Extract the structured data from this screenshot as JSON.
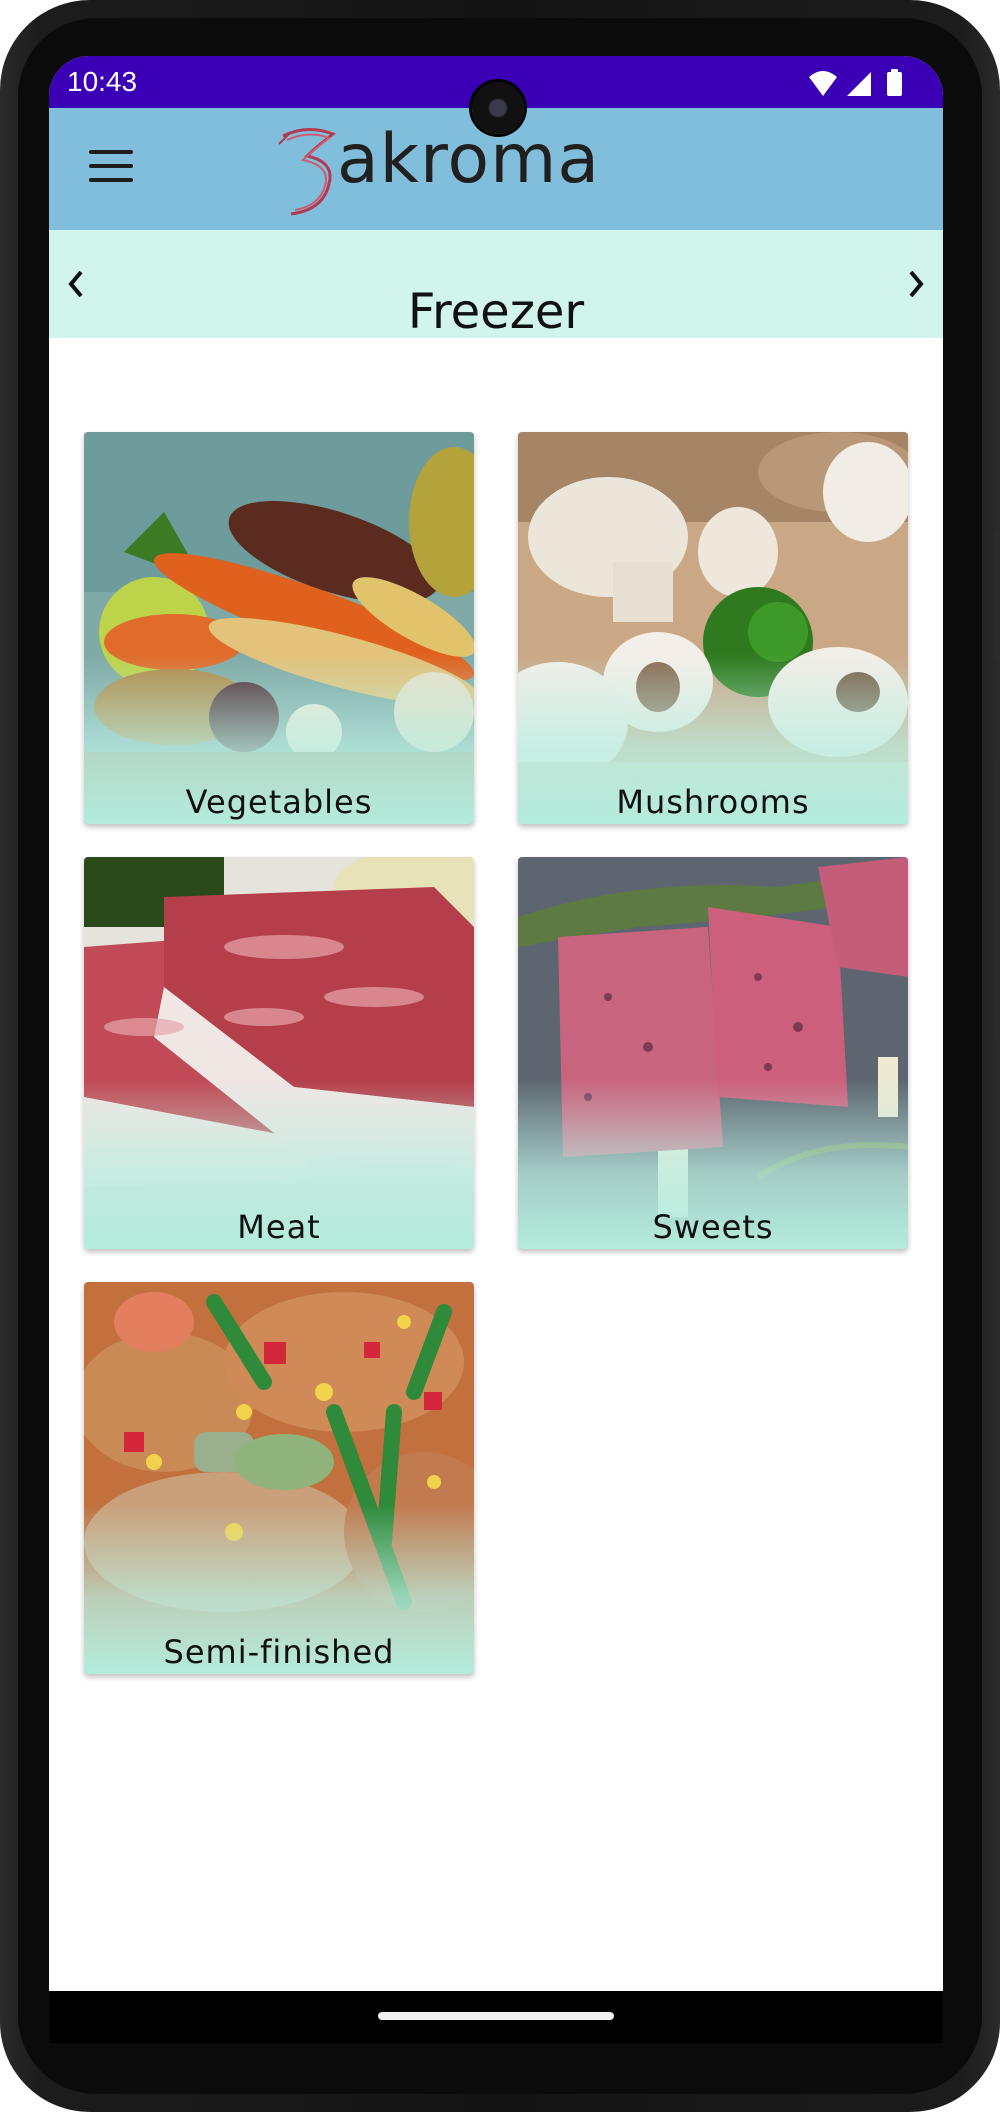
{
  "status_bar": {
    "time": "10:43",
    "icons": [
      "wifi-icon",
      "signal-icon",
      "battery-icon"
    ],
    "background": "#3b00b6"
  },
  "app_bar": {
    "brand_initial": "3",
    "brand_name": "akroma",
    "background": "#80bedc",
    "menu_icon": "hamburger-menu-icon"
  },
  "category_header": {
    "title": "Freezer",
    "prev_icon": "chevron-left-icon",
    "next_icon": "chevron-right-icon",
    "background": "#d1f5ec"
  },
  "categories": [
    {
      "label": "Vegetables"
    },
    {
      "label": "Mushrooms"
    },
    {
      "label": "Meat"
    },
    {
      "label": "Sweets"
    },
    {
      "label": "Semi-finished"
    }
  ],
  "colors": {
    "card_fade": "#b4ecdd"
  }
}
